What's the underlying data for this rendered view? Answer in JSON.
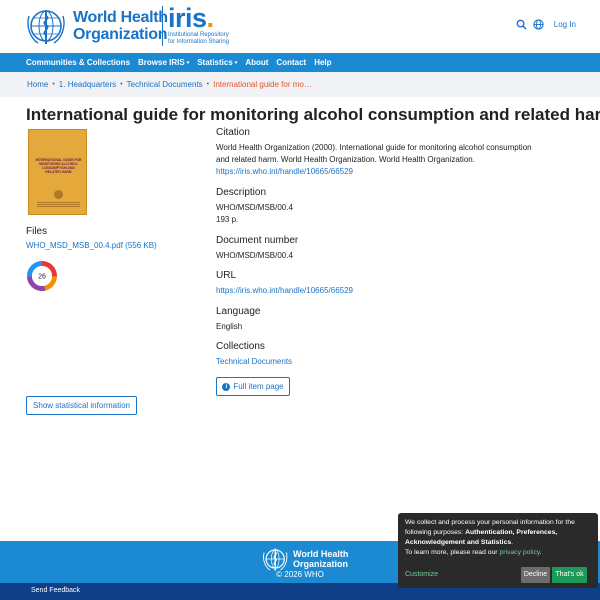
{
  "header": {
    "org_line1": "World Health",
    "org_line2": "Organization",
    "iris_word": "iris",
    "iris_dot": ".",
    "iris_sub_line1": "Institutional Repository",
    "iris_sub_line2": "for Information Sharing",
    "login_label": "Log In",
    "icons": [
      "search-icon",
      "globe-icon"
    ]
  },
  "nav": {
    "items": [
      {
        "label": "Communities & Collections",
        "dropdown": false
      },
      {
        "label": "Browse IRIS",
        "dropdown": true
      },
      {
        "label": "Statistics",
        "dropdown": true
      },
      {
        "label": "About",
        "dropdown": false
      },
      {
        "label": "Contact",
        "dropdown": false
      },
      {
        "label": "Help",
        "dropdown": false
      }
    ],
    "caret": "▾"
  },
  "breadcrumb": {
    "items": [
      "Home",
      "1. Headquarters",
      "Technical Documents"
    ],
    "active": "International guide for mo…",
    "separator": "•"
  },
  "page": {
    "title": "International guide for monitoring alcohol consumption and related harm"
  },
  "thumbnail": {
    "text": "INTERNATIONAL GUIDE FOR MONITORING ALCOHOL CONSUMPTION AND RELATED HARM"
  },
  "files": {
    "label": "Files",
    "link": "WHO_MSD_MSB_00.4.pdf (556 KB)"
  },
  "altmetric": {
    "score": "26"
  },
  "metadata": {
    "citation_label": "Citation",
    "citation_text": "World Health Organization (2000). International guide for monitoring alcohol consumption and related harm. World Health Organization. World Health Organization.",
    "citation_link": "https://iris.who.int/handle/10665/66529",
    "description_label": "Description",
    "description_line1": "WHO/MSD/MSB/00.4",
    "description_line2": "193 p.",
    "docnum_label": "Document number",
    "docnum_value": "WHO/MSD/MSB/00.4",
    "url_label": "URL",
    "url_value": "https://iris.who.int/handle/10665/66529",
    "language_label": "Language",
    "language_value": "English",
    "collections_label": "Collections",
    "collections_value": "Technical Documents"
  },
  "buttons": {
    "full_item": "Full item page",
    "stats": "Show statistical information"
  },
  "footer": {
    "logo_line1": "World Health",
    "logo_line2": "Organization",
    "copyright": "© 2026 WHO",
    "send_feedback": "Send Feedback"
  },
  "cookie": {
    "line1": "We collect and process your personal information for the following purposes: ",
    "purposes": "Authentication, Preferences, Acknowledgement and Statistics",
    "period": ".",
    "learn_more": "To learn more, please read our ",
    "policy_link": "privacy policy",
    "end": ".",
    "customize": "Customize",
    "decline": "Decline",
    "ok": "That's ok"
  },
  "colors": {
    "brand_blue": "#1b8ad2",
    "link_blue": "#1a73c7",
    "active_crumb": "#e8542c",
    "cookie_ok": "#1e9a58"
  }
}
